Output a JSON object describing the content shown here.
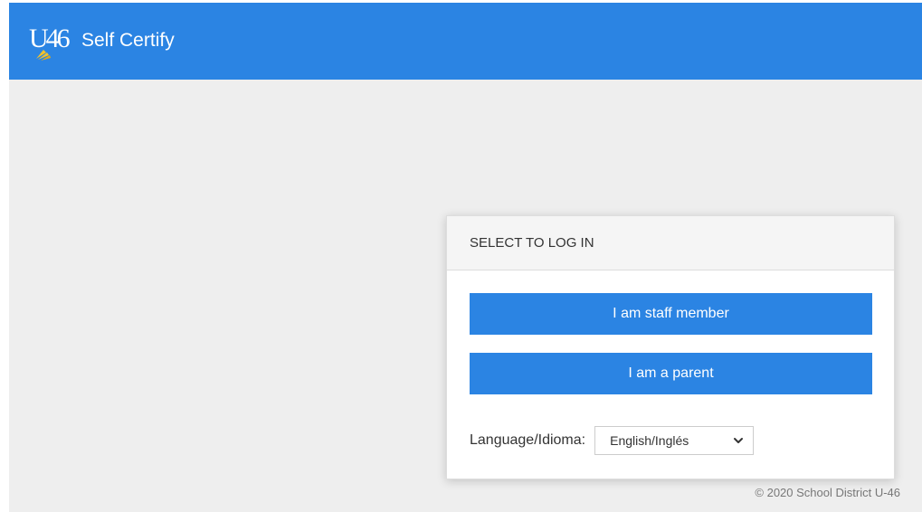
{
  "header": {
    "logo_text": "U46",
    "title": "Self Certify"
  },
  "login_panel": {
    "heading": "SELECT TO LOG IN",
    "staff_button_label": "I am staff member",
    "parent_button_label": "I am a parent",
    "language_label": "Language/Idioma:",
    "language_selected": "English/Inglés"
  },
  "footer": {
    "copyright": "© 2020 School District U-46"
  },
  "colors": {
    "primary": "#2b84e3",
    "background": "#eeeeee",
    "bell": "#f2c22b"
  },
  "icons": {
    "logo": "u46-bell-logo",
    "select_arrow": "chevron-down-icon"
  }
}
